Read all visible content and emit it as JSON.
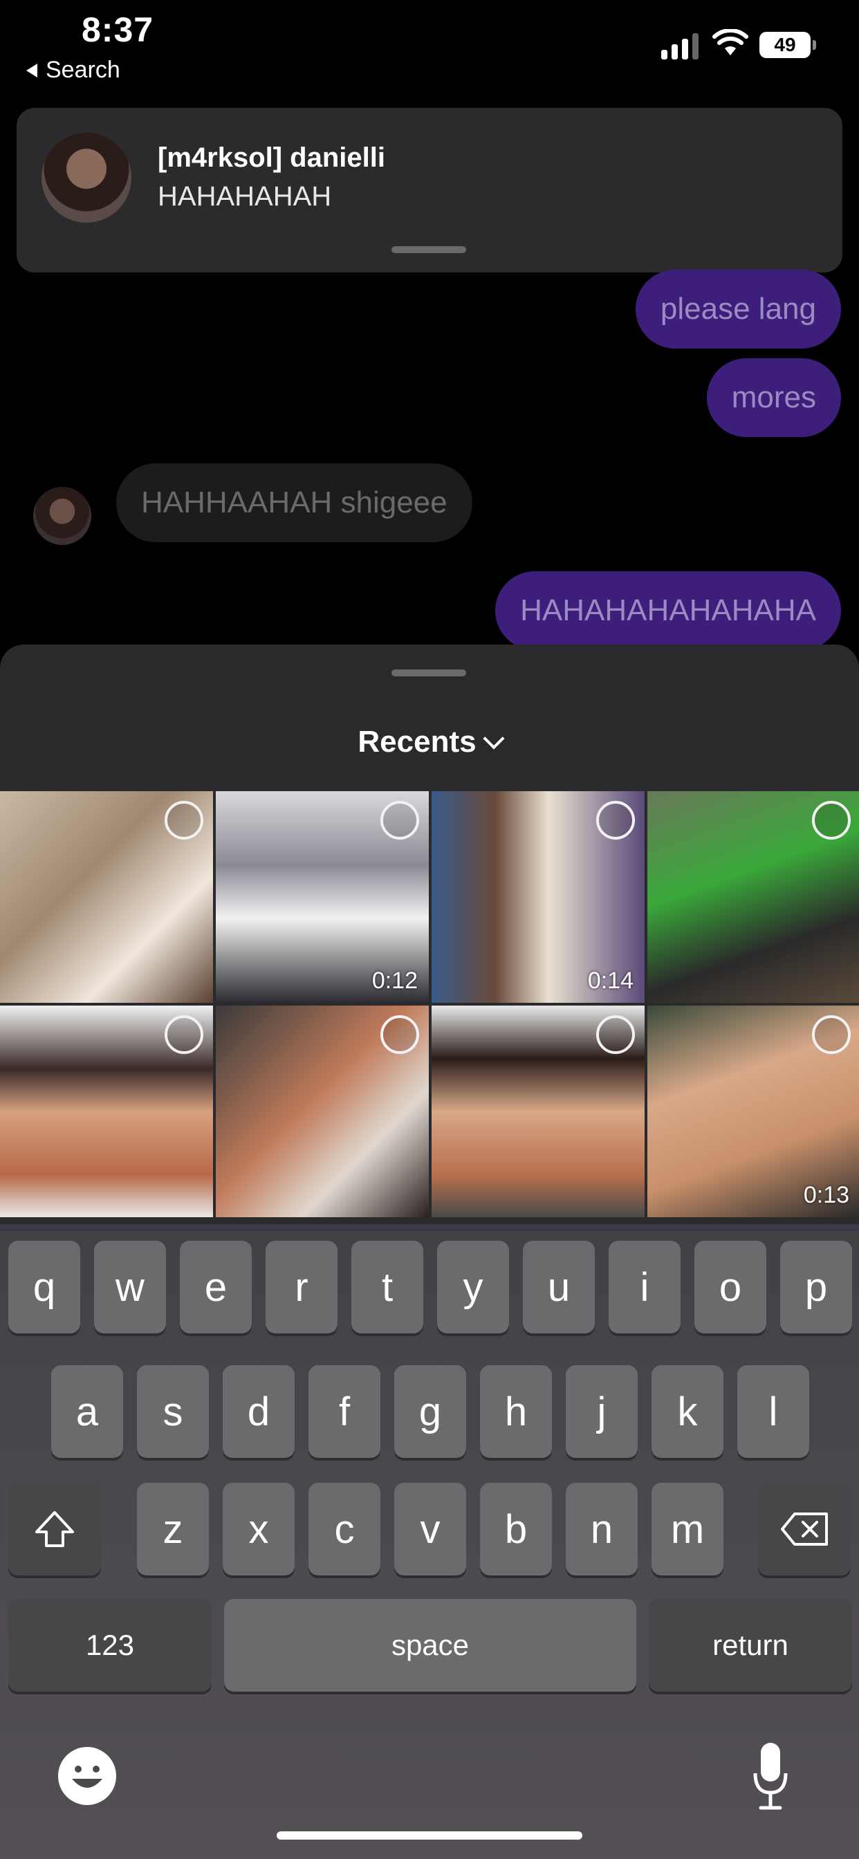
{
  "status_bar": {
    "time": "8:37",
    "back_label": "Search",
    "battery": "49"
  },
  "notification": {
    "title": "[m4rksol] danielli",
    "message": "HAHAHAHAH"
  },
  "messages": [
    {
      "text": "please lang",
      "dir": "out"
    },
    {
      "text": "mores",
      "dir": "out"
    },
    {
      "text": "HAHHAAHAH shigeee",
      "dir": "in"
    },
    {
      "text": "HAHAHAHAHAHAHA",
      "dir": "out"
    }
  ],
  "picker": {
    "album_label": "Recents",
    "photos": [
      {
        "kind": "selfie-thumbsup",
        "duration": ""
      },
      {
        "kind": "hall-video",
        "duration": "0:12"
      },
      {
        "kind": "sign-video",
        "duration": "0:14"
      },
      {
        "kind": "motorcycle",
        "duration": ""
      },
      {
        "kind": "pillow-selfie",
        "duration": ""
      },
      {
        "kind": "pillow-tilted",
        "duration": ""
      },
      {
        "kind": "pillow-selfie-2",
        "duration": ""
      },
      {
        "kind": "boy-face",
        "duration": "0:13"
      }
    ]
  },
  "keyboard": {
    "row1": [
      "q",
      "w",
      "e",
      "r",
      "t",
      "y",
      "u",
      "i",
      "o",
      "p"
    ],
    "row2": [
      "a",
      "s",
      "d",
      "f",
      "g",
      "h",
      "j",
      "k",
      "l"
    ],
    "row3": [
      "z",
      "x",
      "c",
      "v",
      "b",
      "n",
      "m"
    ],
    "numbers_label": "123",
    "space_label": "space",
    "return_label": "return"
  },
  "colors": {
    "outgoing_bubble": "#3d1e7a",
    "incoming_bubble": "#1c1c1e",
    "sheet_bg": "#2a2a2c"
  }
}
